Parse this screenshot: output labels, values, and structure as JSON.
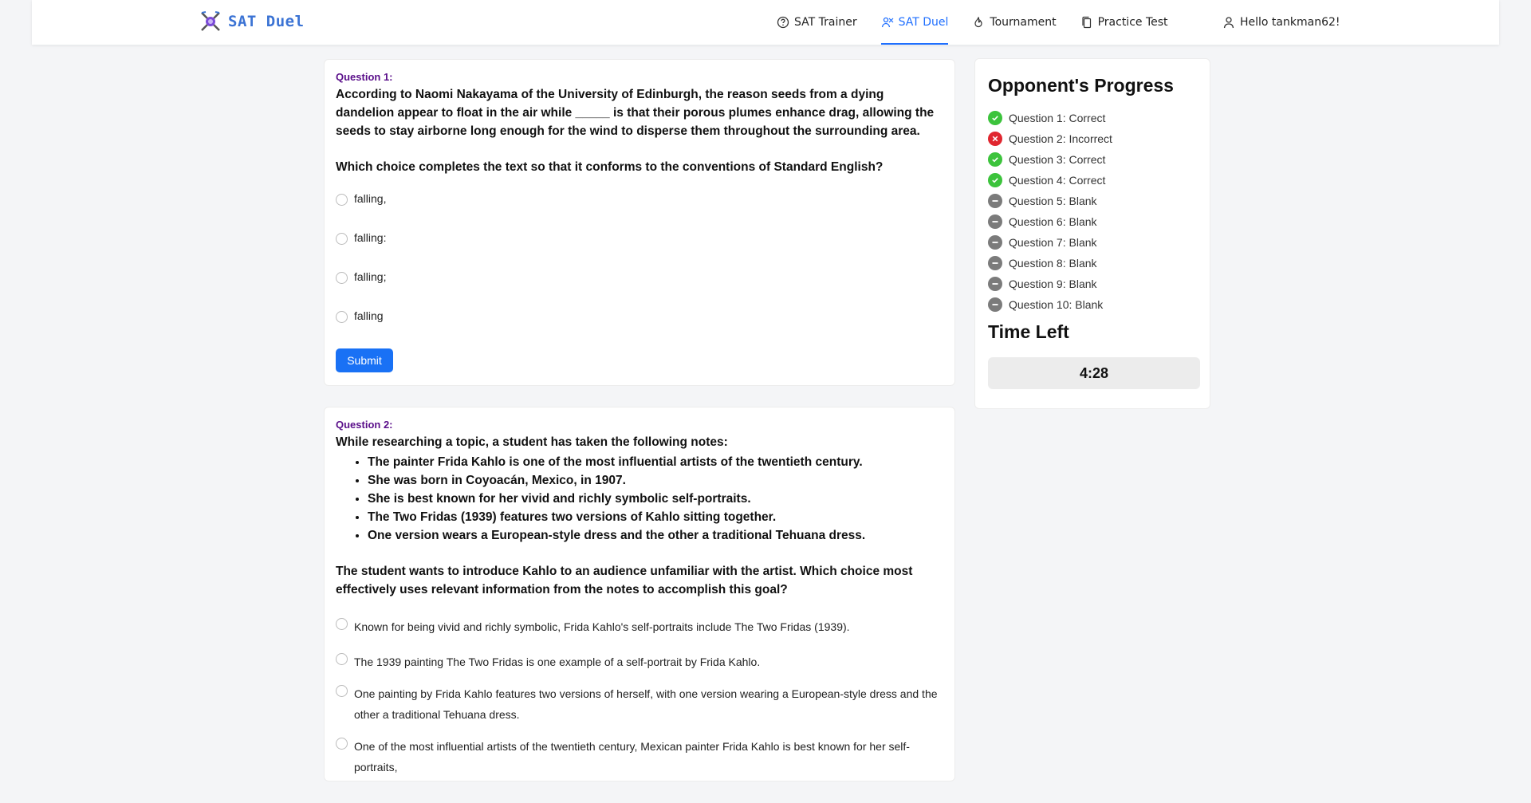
{
  "header": {
    "logo_text": "SAT Duel",
    "nav": [
      {
        "label": "SAT Trainer",
        "icon": "help-circle-icon",
        "active": false
      },
      {
        "label": "SAT Duel",
        "icon": "duel-icon",
        "active": true
      },
      {
        "label": "Tournament",
        "icon": "flame-icon",
        "active": false
      },
      {
        "label": "Practice Test",
        "icon": "copy-icon",
        "active": false
      }
    ],
    "user_label": "Hello tankman62!",
    "accent": "#1f6fff"
  },
  "question1": {
    "label": "Question 1:",
    "text": "According to Naomi Nakayama of the University of Edinburgh, the reason seeds from a dying dandelion appear to float in the air while _____ is that their porous plumes enhance drag, allowing the seeds to stay airborne long enough for the wind to disperse them throughout the surrounding area.",
    "ask": "Which choice completes the text so that it conforms to the conventions of Standard English?",
    "choices": [
      "falling,",
      "falling:",
      "falling;",
      "falling"
    ],
    "submit_label": "Submit"
  },
  "question2": {
    "label": "Question 2:",
    "intro": "While researching a topic, a student has taken the following notes:",
    "notes": [
      "The painter Frida Kahlo is one of the most influential artists of the twentieth century.",
      "She was born in Coyoacán, Mexico, in 1907.",
      "She is best known for her vivid and richly symbolic self-portraits.",
      "The Two Fridas (1939) features two versions of Kahlo sitting together.",
      "One version wears a European-style dress and the other a traditional Tehuana dress."
    ],
    "ask": "The student wants to introduce Kahlo to an audience unfamiliar with the artist. Which choice most effectively uses relevant information from the notes to accomplish this goal?",
    "choices": [
      "Known for being vivid and richly symbolic, Frida Kahlo's self-portraits include The Two Fridas (1939).",
      "The 1939 painting The Two Fridas is one example of a self-portrait by Frida Kahlo.",
      "One painting by Frida Kahlo features two versions of herself, with one version wearing a European-style dress and the other a traditional Tehuana dress.",
      "One of the most influential artists of the twentieth century, Mexican painter Frida Kahlo is best known for her self- portraits,"
    ]
  },
  "sidebar": {
    "progress_title": "Opponent's Progress",
    "progress": [
      {
        "label": "Question 1: Correct",
        "status": "correct"
      },
      {
        "label": "Question 2: Incorrect",
        "status": "incorrect"
      },
      {
        "label": "Question 3: Correct",
        "status": "correct"
      },
      {
        "label": "Question 4: Correct",
        "status": "correct"
      },
      {
        "label": "Question 5: Blank",
        "status": "blank"
      },
      {
        "label": "Question 6: Blank",
        "status": "blank"
      },
      {
        "label": "Question 7: Blank",
        "status": "blank"
      },
      {
        "label": "Question 8: Blank",
        "status": "blank"
      },
      {
        "label": "Question 9: Blank",
        "status": "blank"
      },
      {
        "label": "Question 10: Blank",
        "status": "blank"
      }
    ],
    "time_title": "Time Left",
    "time_value": "4:28",
    "colors": {
      "correct": "#3cc33c",
      "incorrect": "#e0262f",
      "blank": "#7b7b7b"
    }
  }
}
